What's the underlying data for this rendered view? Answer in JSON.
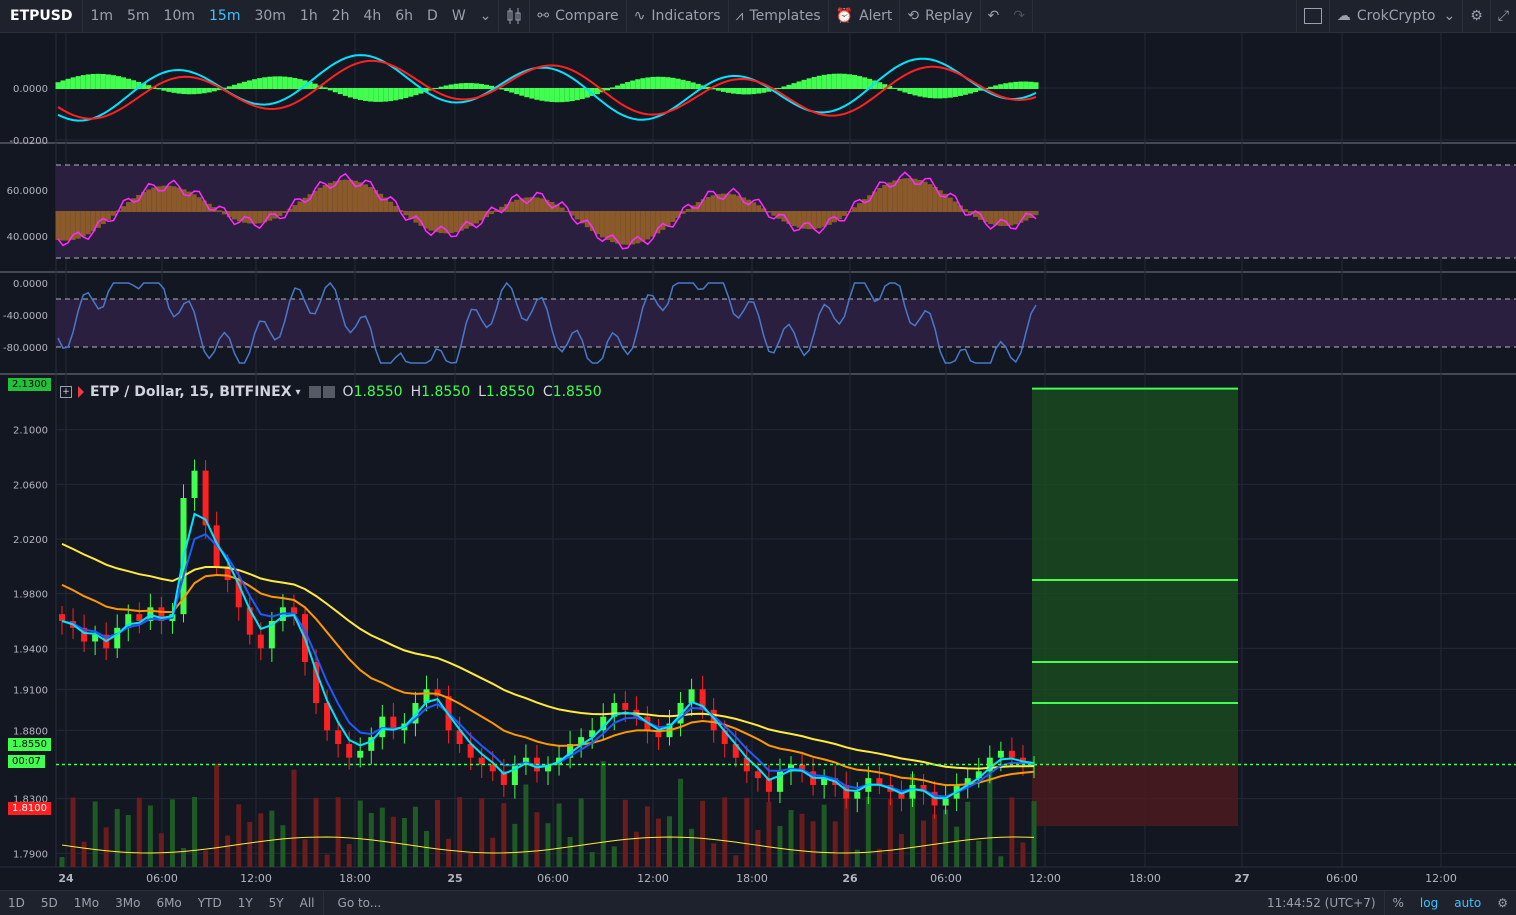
{
  "toolbar": {
    "symbol": "ETPUSD",
    "intervals": [
      "1m",
      "5m",
      "10m",
      "15m",
      "30m",
      "1h",
      "2h",
      "4h",
      "6h",
      "D",
      "W"
    ],
    "active_interval": "15m",
    "compare": "Compare",
    "indicators": "Indicators",
    "templates": "Templates",
    "alert": "Alert",
    "replay": "Replay",
    "layout_name": "CrokCrypto"
  },
  "legend": {
    "title": "ETP / Dollar, 15, BITFINEX",
    "o_label": "O",
    "o": "1.8550",
    "h_label": "H",
    "h": "1.8550",
    "l_label": "L",
    "l": "1.8550",
    "c_label": "C",
    "c": "1.8550"
  },
  "price_axis": {
    "labels": [
      "2.1000",
      "2.0600",
      "2.0200",
      "1.9800",
      "1.9400",
      "1.9100",
      "1.8800",
      "1.8300",
      "1.7900"
    ],
    "target_tag": "2.1300",
    "last_price_tag": "1.8550",
    "countdown_tag": "00:07",
    "stop_tag": "1.8100"
  },
  "macd_axis": [
    "0.0000",
    "-0.0200"
  ],
  "rsi_axis": [
    "60.0000",
    "40.0000"
  ],
  "willr_axis": [
    "0.0000",
    "-40.0000",
    "-80.0000"
  ],
  "time_axis": [
    "24",
    "06:00",
    "12:00",
    "18:00",
    "25",
    "06:00",
    "12:00",
    "18:00",
    "26",
    "06:00",
    "12:00",
    "18:00",
    "27",
    "06:00",
    "12:00"
  ],
  "bottom": {
    "ranges": [
      "1D",
      "5D",
      "1Mo",
      "3Mo",
      "6Mo",
      "YTD",
      "1Y",
      "5Y",
      "All"
    ],
    "goto": "Go to...",
    "clock": "11:44:52 (UTC+7)",
    "percent": "%",
    "log": "log",
    "auto": "auto"
  },
  "colors": {
    "up": "#41ff4e",
    "down": "#ff2121",
    "ema_fast": "#00e5ff",
    "ema_mid": "#1e5bff",
    "ema_orange": "#ff9800",
    "ema_yellow": "#ffeb3b",
    "profit": "#1a4a1f",
    "loss": "#4a1a1f"
  },
  "chart_data": {
    "type": "candlestick",
    "ylim": [
      1.78,
      2.14
    ],
    "close_series": [
      1.96,
      1.955,
      1.945,
      1.95,
      1.94,
      1.955,
      1.965,
      1.96,
      1.97,
      1.96,
      1.965,
      2.05,
      2.07,
      2.03,
      2.0,
      1.99,
      1.97,
      1.95,
      1.94,
      1.96,
      1.97,
      1.965,
      1.93,
      1.9,
      1.88,
      1.87,
      1.86,
      1.865,
      1.875,
      1.89,
      1.88,
      1.885,
      1.9,
      1.91,
      1.905,
      1.88,
      1.87,
      1.86,
      1.855,
      1.85,
      1.84,
      1.855,
      1.86,
      1.85,
      1.855,
      1.86,
      1.87,
      1.875,
      1.88,
      1.89,
      1.9,
      1.895,
      1.89,
      1.88,
      1.875,
      1.885,
      1.9,
      1.91,
      1.895,
      1.88,
      1.87,
      1.86,
      1.85,
      1.845,
      1.835,
      1.85,
      1.855,
      1.85,
      1.84,
      1.845,
      1.84,
      1.83,
      1.835,
      1.845,
      1.84,
      1.835,
      1.83,
      1.84,
      1.835,
      1.825,
      1.83,
      1.84,
      1.845,
      1.85,
      1.86,
      1.865,
      1.86,
      1.855,
      1.855
    ],
    "target_levels": [
      2.13,
      1.99,
      1.93,
      1.9
    ],
    "entry": 1.855,
    "stop": 1.81,
    "last_price": 1.855
  }
}
